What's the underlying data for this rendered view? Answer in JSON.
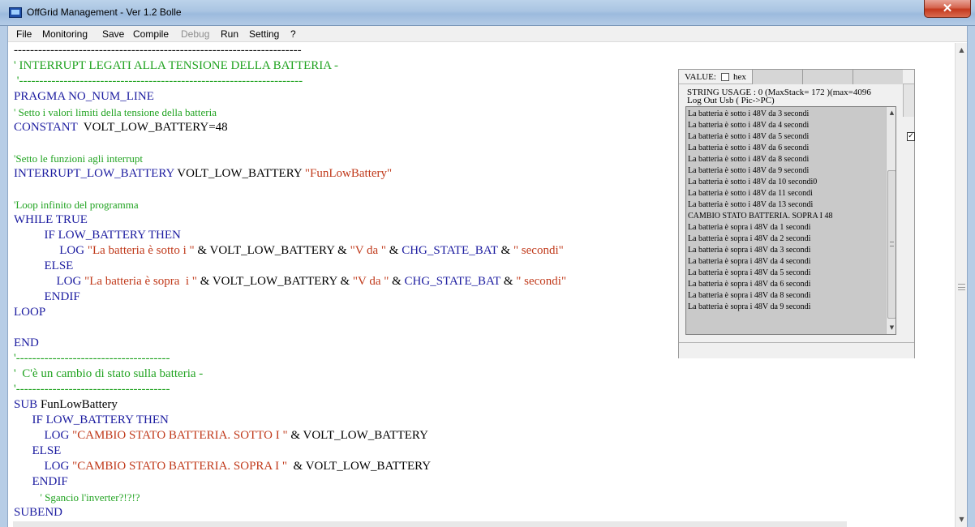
{
  "window": {
    "title": "OffGrid Management - Ver 1.2 Bolle",
    "close_glyph": "✕"
  },
  "menu": {
    "items": [
      {
        "label": "File",
        "enabled": true
      },
      {
        "label": "Monitoring",
        "enabled": true
      },
      {
        "label": "Save",
        "enabled": true
      },
      {
        "label": "Compile",
        "enabled": true
      },
      {
        "label": "Debug",
        "enabled": false
      },
      {
        "label": "Run",
        "enabled": true
      },
      {
        "label": "Setting",
        "enabled": true
      },
      {
        "label": "?",
        "enabled": true
      }
    ]
  },
  "colors": {
    "keyword": "#1c1ca0",
    "comment": "#21a321",
    "string": "#c0391a",
    "plain": "#000000"
  },
  "code": {
    "lines": [
      {
        "segments": [
          {
            "t": "-----------------------------------------------------------------------",
            "k": "nm"
          }
        ]
      },
      {
        "segments": [
          {
            "t": "' INTERRUPT LEGATI ALLA TENSIONE DELLA BATTERIA -",
            "k": "cm"
          }
        ]
      },
      {
        "segments": [
          {
            "t": " '----------------------------------------------------------------------",
            "k": "cm"
          }
        ]
      },
      {
        "segments": [
          {
            "t": "PRAGMA NO_NUM_LINE",
            "k": "kw"
          }
        ]
      },
      {
        "segments": [
          {
            "t": "' Setto i valori limiti della tensione della batteria",
            "k": "cm",
            "small": true
          }
        ]
      },
      {
        "segments": [
          {
            "t": "CONSTANT ",
            "k": "kw"
          },
          {
            "t": " VOLT_LOW_BATTERY=48",
            "k": "nm"
          }
        ]
      },
      {
        "segments": []
      },
      {
        "segments": [
          {
            "t": "'Setto le funzioni agli interrupt",
            "k": "cm",
            "small": true
          }
        ]
      },
      {
        "segments": [
          {
            "t": "INTERRUPT_LOW_BATTERY",
            "k": "kw"
          },
          {
            "t": " VOLT_LOW_BATTERY ",
            "k": "nm"
          },
          {
            "t": "\"FunLowBattery\"",
            "k": "st"
          }
        ]
      },
      {
        "segments": []
      },
      {
        "segments": [
          {
            "t": "'Loop infinito del programma",
            "k": "cm",
            "small": true
          }
        ]
      },
      {
        "segments": [
          {
            "t": "WHILE TRUE",
            "k": "kw"
          }
        ]
      },
      {
        "segments": [
          {
            "t": "          IF LOW_BATTERY THEN",
            "k": "kw"
          }
        ]
      },
      {
        "segments": [
          {
            "t": "               LOG ",
            "k": "kw"
          },
          {
            "t": "\"La batteria è sotto i \"",
            "k": "st"
          },
          {
            "t": " & VOLT_LOW_BATTERY & ",
            "k": "nm"
          },
          {
            "t": "\"V da \"",
            "k": "st"
          },
          {
            "t": " & ",
            "k": "nm"
          },
          {
            "t": "CHG_STATE_BAT",
            "k": "kw"
          },
          {
            "t": " & ",
            "k": "nm"
          },
          {
            "t": "\" secondi\"",
            "k": "st"
          }
        ]
      },
      {
        "segments": [
          {
            "t": "          ELSE",
            "k": "kw"
          }
        ]
      },
      {
        "segments": [
          {
            "t": "              LOG ",
            "k": "kw"
          },
          {
            "t": "\"La batteria è sopra  i \"",
            "k": "st"
          },
          {
            "t": " & VOLT_LOW_BATTERY & ",
            "k": "nm"
          },
          {
            "t": "\"V da \"",
            "k": "st"
          },
          {
            "t": " & ",
            "k": "nm"
          },
          {
            "t": "CHG_STATE_BAT",
            "k": "kw"
          },
          {
            "t": " & ",
            "k": "nm"
          },
          {
            "t": "\" secondi\"",
            "k": "st"
          }
        ]
      },
      {
        "segments": [
          {
            "t": "          ENDIF",
            "k": "kw"
          }
        ]
      },
      {
        "segments": [
          {
            "t": "LOOP",
            "k": "kw"
          }
        ]
      },
      {
        "segments": []
      },
      {
        "segments": [
          {
            "t": "END",
            "k": "kw"
          }
        ]
      },
      {
        "segments": [
          {
            "t": "'--------------------------------------",
            "k": "cm"
          }
        ]
      },
      {
        "segments": [
          {
            "t": "'  C'è un cambio di stato sulla batteria -",
            "k": "cm"
          }
        ]
      },
      {
        "segments": [
          {
            "t": "'--------------------------------------",
            "k": "cm"
          }
        ]
      },
      {
        "segments": [
          {
            "t": "SUB ",
            "k": "kw"
          },
          {
            "t": "FunLowBattery",
            "k": "nm"
          }
        ]
      },
      {
        "segments": [
          {
            "t": "      IF LOW_BATTERY THEN",
            "k": "kw"
          }
        ]
      },
      {
        "segments": [
          {
            "t": "          LOG ",
            "k": "kw"
          },
          {
            "t": "\"CAMBIO STATO BATTERIA. SOTTO I \"",
            "k": "st"
          },
          {
            "t": " & VOLT_LOW_BATTERY",
            "k": "nm"
          }
        ]
      },
      {
        "segments": [
          {
            "t": "      ELSE",
            "k": "kw"
          }
        ]
      },
      {
        "segments": [
          {
            "t": "          LOG ",
            "k": "kw"
          },
          {
            "t": "\"CAMBIO STATO BATTERIA. SOPRA I \"",
            "k": "st"
          },
          {
            "t": "  & VOLT_LOW_BATTERY",
            "k": "nm"
          }
        ]
      },
      {
        "segments": [
          {
            "t": "      ENDIF",
            "k": "kw"
          }
        ]
      },
      {
        "segments": [
          {
            "t": "          ' Sgancio l'inverter?!?!?",
            "k": "cm",
            "small": true
          }
        ]
      },
      {
        "segments": [
          {
            "t": "SUBEND",
            "k": "kw"
          }
        ]
      }
    ]
  },
  "panel": {
    "value_label": "VALUE:",
    "hex_label": "hex",
    "string_usage": "STRING USAGE   :       0  (MaxStack=   172 )(max=4096",
    "log_title": "Log  Out Usb ( Pic->PC)",
    "log_lines": [
      "La batteria è sotto i 48V da 3 secondi",
      "La batteria è sotto i 48V da 4 secondi",
      "La batteria è sotto i 48V da 5 secondi",
      "La batteria è sotto i 48V da 6 secondi",
      "La batteria è sotto i 48V da 8 secondi",
      "La batteria è sotto i 48V da 9 secondi",
      "La batteria è sotto i 48V da 10 secondi0",
      "La batteria è sotto i 48V da 11 secondi",
      "La batteria è sotto i 48V da 13 secondi",
      "CAMBIO STATO BATTERIA. SOPRA I 48",
      "La batteria è sopra  i 48V da 1 secondi",
      "La batteria è sopra  i 48V da 2 secondi",
      "La batteria è sopra  i 48V da 3 secondi",
      "La batteria è sopra  i 48V da 4 secondi",
      "La batteria è sopra  i 48V da 5 secondi",
      "La batteria è sopra  i 48V da 6 secondi",
      "La batteria è sopra  i 48V da 8 secondi",
      "La batteria è sopra  i 48V da 9 secondi"
    ],
    "outer_check_glyph": "✓"
  }
}
